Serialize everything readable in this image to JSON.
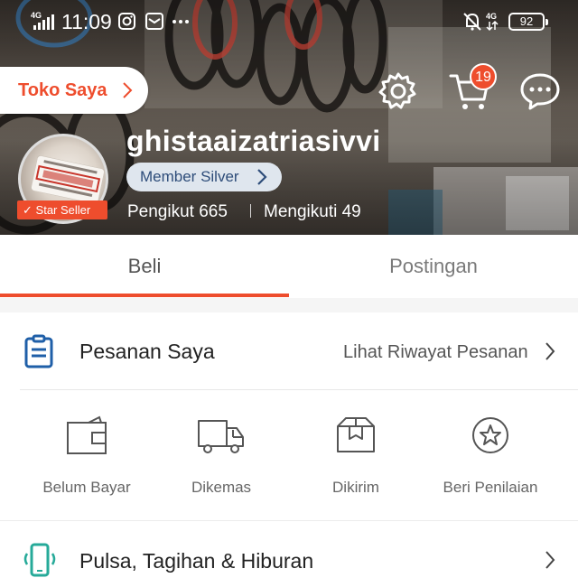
{
  "status_bar": {
    "network_left": "4G",
    "time": "11:09",
    "network_right": "4G",
    "battery": "92"
  },
  "header": {
    "shop_button": "Toko Saya",
    "cart_count": "19"
  },
  "profile": {
    "username": "ghistaaizatriasivvi",
    "membership": "Member Silver",
    "badge": "Star Seller",
    "followers": "Pengikut 665",
    "following": "Mengikuti 49"
  },
  "tabs": [
    "Beli",
    "Postingan"
  ],
  "orders": {
    "title": "Pesanan Saya",
    "history_link": "Lihat Riwayat Pesanan",
    "items": [
      {
        "label": "Belum Bayar",
        "icon": "wallet-icon"
      },
      {
        "label": "Dikemas",
        "icon": "truck-icon"
      },
      {
        "label": "Dikirim",
        "icon": "package-icon"
      },
      {
        "label": "Beri Penilaian",
        "icon": "star-icon"
      }
    ]
  },
  "digital": {
    "title": "Pulsa, Tagihan & Hiburan"
  },
  "colors": {
    "accent": "#ee4d2d",
    "member_text": "#2e4d7a",
    "icon_blue": "#1f5fa8",
    "icon_teal": "#26aa99"
  }
}
